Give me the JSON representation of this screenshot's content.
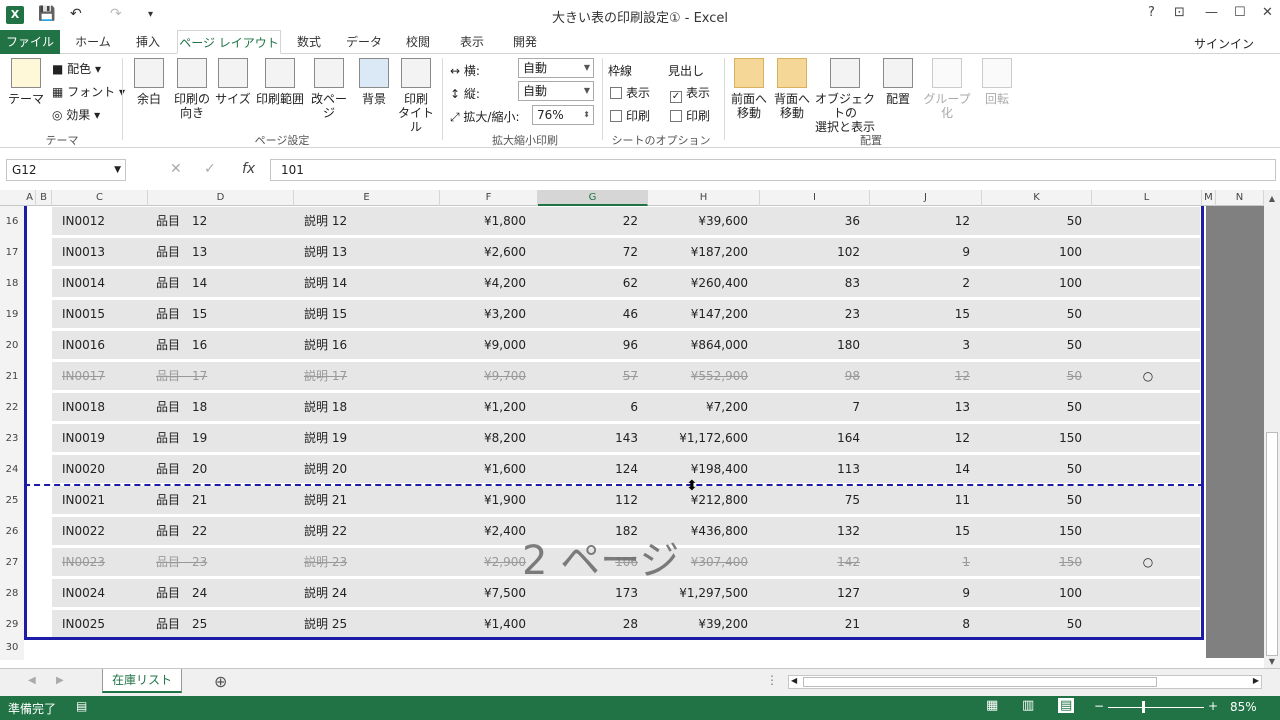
{
  "window": {
    "title": "大きい表の印刷設定① - Excel",
    "app_icon": "X",
    "help": "?",
    "restore_ribbon": "⊡",
    "minimize": "—",
    "maximize": "☐",
    "close": "✕"
  },
  "qat": {
    "save_icon": "💾",
    "undo_icon": "↶",
    "redo_icon": "↷",
    "more_icon": "▾"
  },
  "tabs": [
    "ファイル",
    "ホーム",
    "挿入",
    "ページ レイアウト",
    "数式",
    "データ",
    "校閲",
    "表示",
    "開発"
  ],
  "active_tab": "ページ レイアウト",
  "signin": "サインイン",
  "ribbon": {
    "theme": {
      "theme_button": "テーマ",
      "colors": "配色",
      "fonts": "フォント",
      "effects": "効果",
      "group": "テーマ"
    },
    "page_setup": {
      "margins": "余白",
      "orientation_1": "印刷の",
      "orientation_2": "向き",
      "size": "サイズ",
      "print_area": "印刷範囲",
      "breaks": "改ページ",
      "background": "背景",
      "titles_1": "印刷",
      "titles_2": "タイトル",
      "group": "ページ設定"
    },
    "scale": {
      "width_label": "横:",
      "width_value": "自動",
      "height_label": "縦:",
      "height_value": "自動",
      "scale_label": "拡大/縮小:",
      "scale_value": "76%",
      "group": "拡大縮小印刷"
    },
    "sheet_options": {
      "gridlines": "枠線",
      "headings": "見出し",
      "view": "表示",
      "print": "印刷",
      "group": "シートのオプション"
    },
    "arrange": {
      "bring_forward_1": "前面へ",
      "bring_forward_2": "移動",
      "send_backward_1": "背面へ",
      "send_backward_2": "移動",
      "selection_pane_1": "オブジェクトの",
      "selection_pane_2": "選択と表示",
      "align": "配置",
      "group_btn": "グループ化",
      "rotate": "回転",
      "group": "配置"
    }
  },
  "formula_bar": {
    "name_box": "G12",
    "cancel": "✕",
    "enter": "✓",
    "fx": "fx",
    "value": "101"
  },
  "columns": [
    "A",
    "B",
    "C",
    "D",
    "E",
    "F",
    "G",
    "H",
    "I",
    "J",
    "K",
    "L",
    "M",
    "N"
  ],
  "selected_column": "G",
  "rows": [
    {
      "n": "16",
      "id": "IN0012",
      "item": "品目　12",
      "desc": "説明 12",
      "price": "¥1,800",
      "qty": "22",
      "amount": "¥39,600",
      "i": "36",
      "j": "12",
      "k": "50",
      "l": "",
      "strike": false
    },
    {
      "n": "17",
      "id": "IN0013",
      "item": "品目　13",
      "desc": "説明 13",
      "price": "¥2,600",
      "qty": "72",
      "amount": "¥187,200",
      "i": "102",
      "j": "9",
      "k": "100",
      "l": "",
      "strike": false
    },
    {
      "n": "18",
      "id": "IN0014",
      "item": "品目　14",
      "desc": "説明 14",
      "price": "¥4,200",
      "qty": "62",
      "amount": "¥260,400",
      "i": "83",
      "j": "2",
      "k": "100",
      "l": "",
      "strike": false
    },
    {
      "n": "19",
      "id": "IN0015",
      "item": "品目　15",
      "desc": "説明 15",
      "price": "¥3,200",
      "qty": "46",
      "amount": "¥147,200",
      "i": "23",
      "j": "15",
      "k": "50",
      "l": "",
      "strike": false
    },
    {
      "n": "20",
      "id": "IN0016",
      "item": "品目　16",
      "desc": "説明 16",
      "price": "¥9,000",
      "qty": "96",
      "amount": "¥864,000",
      "i": "180",
      "j": "3",
      "k": "50",
      "l": "",
      "strike": false
    },
    {
      "n": "21",
      "id": "IN0017",
      "item": "品目　17",
      "desc": "説明 17",
      "price": "¥9,700",
      "qty": "57",
      "amount": "¥552,900",
      "i": "98",
      "j": "12",
      "k": "50",
      "l": "○",
      "strike": true
    },
    {
      "n": "22",
      "id": "IN0018",
      "item": "品目　18",
      "desc": "説明 18",
      "price": "¥1,200",
      "qty": "6",
      "amount": "¥7,200",
      "i": "7",
      "j": "13",
      "k": "50",
      "l": "",
      "strike": false
    },
    {
      "n": "23",
      "id": "IN0019",
      "item": "品目　19",
      "desc": "説明 19",
      "price": "¥8,200",
      "qty": "143",
      "amount": "¥1,172,600",
      "i": "164",
      "j": "12",
      "k": "150",
      "l": "",
      "strike": false
    },
    {
      "n": "24",
      "id": "IN0020",
      "item": "品目　20",
      "desc": "説明 20",
      "price": "¥1,600",
      "qty": "124",
      "amount": "¥198,400",
      "i": "113",
      "j": "14",
      "k": "50",
      "l": "",
      "strike": false
    },
    {
      "n": "25",
      "id": "IN0021",
      "item": "品目　21",
      "desc": "説明 21",
      "price": "¥1,900",
      "qty": "112",
      "amount": "¥212,800",
      "i": "75",
      "j": "11",
      "k": "50",
      "l": "",
      "strike": false
    },
    {
      "n": "26",
      "id": "IN0022",
      "item": "品目　22",
      "desc": "説明 22",
      "price": "¥2,400",
      "qty": "182",
      "amount": "¥436,800",
      "i": "132",
      "j": "15",
      "k": "150",
      "l": "",
      "strike": false
    },
    {
      "n": "27",
      "id": "IN0023",
      "item": "品目　23",
      "desc": "説明 23",
      "price": "¥2,900",
      "qty": "106",
      "amount": "¥307,400",
      "i": "142",
      "j": "1",
      "k": "150",
      "l": "○",
      "strike": true
    },
    {
      "n": "28",
      "id": "IN0024",
      "item": "品目　24",
      "desc": "説明 24",
      "price": "¥7,500",
      "qty": "173",
      "amount": "¥1,297,500",
      "i": "127",
      "j": "9",
      "k": "100",
      "l": "",
      "strike": false
    },
    {
      "n": "29",
      "id": "IN0025",
      "item": "品目　25",
      "desc": "説明 25",
      "price": "¥1,400",
      "qty": "28",
      "amount": "¥39,200",
      "i": "21",
      "j": "8",
      "k": "50",
      "l": "",
      "strike": false
    }
  ],
  "extra_row": "30",
  "page_watermark": "2 ページ",
  "sheet": {
    "tab": "在庫リスト",
    "add": "⊕"
  },
  "status": {
    "ready": "準備完了",
    "zoom": "85%"
  },
  "colors": {
    "accent": "#217346",
    "page_break": "#1c1ca8"
  }
}
